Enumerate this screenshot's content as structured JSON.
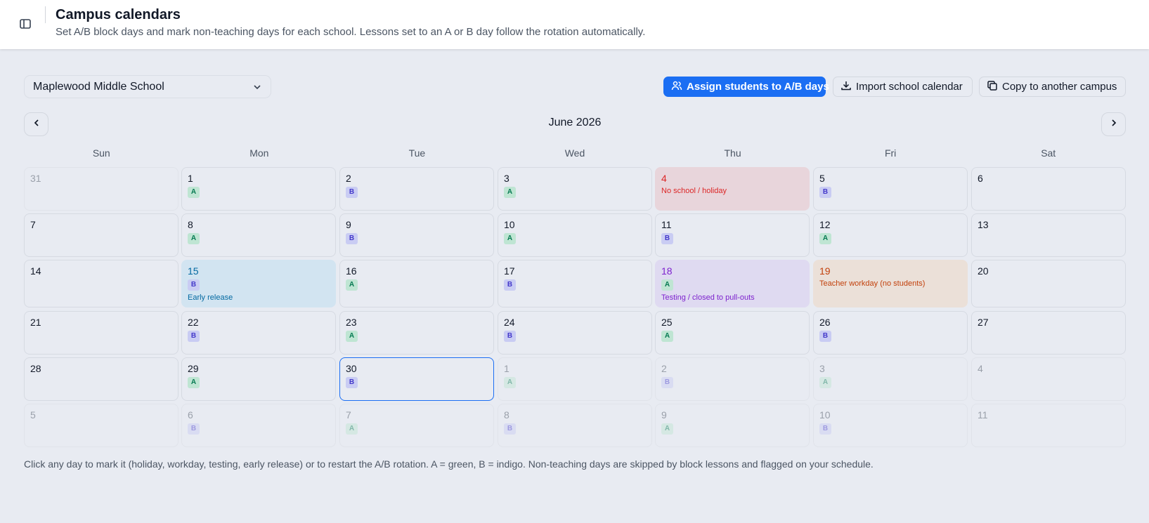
{
  "header": {
    "title": "Campus calendars",
    "subtitle": "Set A/B block days and mark non-teaching days for each school. Lessons set to an A or B day follow the rotation automatically."
  },
  "toolbar": {
    "school": "Maplewood Middle School",
    "assign_label": "Assign students to A/B days",
    "import_label": "Import school calendar",
    "copy_label": "Copy to another campus"
  },
  "calendar": {
    "month": "June 2026",
    "weekdays": [
      "Sun",
      "Mon",
      "Tue",
      "Wed",
      "Thu",
      "Fri",
      "Sat"
    ],
    "weeks": [
      [
        {
          "day": "31",
          "badge": "",
          "faded": true
        },
        {
          "day": "1",
          "badge": "A"
        },
        {
          "day": "2",
          "badge": "B"
        },
        {
          "day": "3",
          "badge": "A"
        },
        {
          "day": "4",
          "badge": "",
          "note": "No school / holiday",
          "status": "holiday"
        },
        {
          "day": "5",
          "badge": "B"
        },
        {
          "day": "6",
          "badge": ""
        }
      ],
      [
        {
          "day": "7",
          "badge": ""
        },
        {
          "day": "8",
          "badge": "A"
        },
        {
          "day": "9",
          "badge": "B"
        },
        {
          "day": "10",
          "badge": "A"
        },
        {
          "day": "11",
          "badge": "B"
        },
        {
          "day": "12",
          "badge": "A"
        },
        {
          "day": "13",
          "badge": ""
        }
      ],
      [
        {
          "day": "14",
          "badge": ""
        },
        {
          "day": "15",
          "badge": "B",
          "note": "Early release",
          "status": "early"
        },
        {
          "day": "16",
          "badge": "A"
        },
        {
          "day": "17",
          "badge": "B"
        },
        {
          "day": "18",
          "badge": "A",
          "note": "Testing / closed to pull-outs",
          "status": "testing"
        },
        {
          "day": "19",
          "badge": "",
          "note": "Teacher workday (no students)",
          "status": "workday"
        },
        {
          "day": "20",
          "badge": ""
        }
      ],
      [
        {
          "day": "21",
          "badge": ""
        },
        {
          "day": "22",
          "badge": "B"
        },
        {
          "day": "23",
          "badge": "A"
        },
        {
          "day": "24",
          "badge": "B"
        },
        {
          "day": "25",
          "badge": "A"
        },
        {
          "day": "26",
          "badge": "B"
        },
        {
          "day": "27",
          "badge": ""
        }
      ],
      [
        {
          "day": "28",
          "badge": ""
        },
        {
          "day": "29",
          "badge": "A"
        },
        {
          "day": "30",
          "badge": "B",
          "today": true
        },
        {
          "day": "1",
          "badge": "A",
          "faded": true
        },
        {
          "day": "2",
          "badge": "B",
          "faded": true
        },
        {
          "day": "3",
          "badge": "A",
          "faded": true
        },
        {
          "day": "4",
          "badge": "",
          "faded": true
        }
      ],
      [
        {
          "day": "5",
          "badge": "",
          "faded": true
        },
        {
          "day": "6",
          "badge": "B",
          "faded": true
        },
        {
          "day": "7",
          "badge": "A",
          "faded": true
        },
        {
          "day": "8",
          "badge": "B",
          "faded": true
        },
        {
          "day": "9",
          "badge": "A",
          "faded": true
        },
        {
          "day": "10",
          "badge": "B",
          "faded": true
        },
        {
          "day": "11",
          "badge": "",
          "faded": true
        }
      ]
    ]
  },
  "footer": {
    "note": "Click any day to mark it (holiday, workday, testing, early release) or to restart the A/B rotation. A = green, B = indigo. Non-teaching days are skipped by block lessons and flagged on your schedule."
  },
  "colors": {
    "accent": "#1b6ef3",
    "a_day": "#067a52",
    "b_day": "#4338ca",
    "holiday": "#dc2626",
    "early_release": "#0369a1",
    "testing": "#7e22ce",
    "workday": "#c2410c"
  },
  "icons": {
    "sidebar": "sidebar-toggle-icon",
    "dropdown": "chevron-down-icon",
    "assign": "users-icon",
    "import": "download-icon",
    "copy": "copy-icon",
    "prev": "chevron-left-icon",
    "next": "chevron-right-icon"
  }
}
